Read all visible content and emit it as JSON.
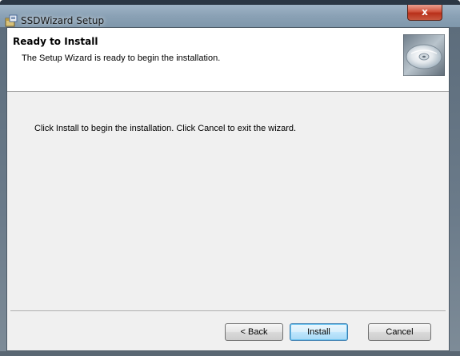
{
  "window": {
    "title": "SSDWizard Setup",
    "close_label": "x"
  },
  "banner": {
    "title": "Ready to Install",
    "subtitle": "The Setup Wizard is ready to begin the installation."
  },
  "body": {
    "message": "Click Install to begin the installation.  Click Cancel to exit the wizard."
  },
  "buttons": {
    "back": "< Back",
    "install": "Install",
    "cancel": "Cancel"
  },
  "icons": {
    "app": "installer-package-icon",
    "banner": "cd-disc-icon"
  }
}
